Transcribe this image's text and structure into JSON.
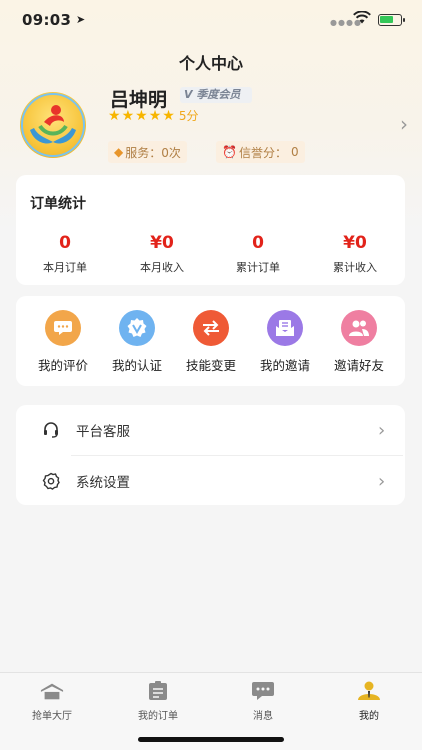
{
  "status": {
    "time": "09:03"
  },
  "page": {
    "title": "个人中心"
  },
  "profile": {
    "name": "吕坤明",
    "vip": "V 季度会员",
    "stars": 5,
    "score": "5分",
    "service_label": "服务：",
    "service_value": "0次",
    "credit_label": "信誉分：",
    "credit_value": "0"
  },
  "order_stats": {
    "title": "订单统计",
    "items": [
      {
        "value": "0",
        "label": "本月订单"
      },
      {
        "value": "¥0",
        "label": "本月收入"
      },
      {
        "value": "0",
        "label": "累计订单"
      },
      {
        "value": "¥0",
        "label": "累计收入"
      }
    ]
  },
  "menu": [
    {
      "label": "我的评价",
      "icon": "comment-icon",
      "color": "#f2a64a"
    },
    {
      "label": "我的认证",
      "icon": "verify-icon",
      "color": "#6fb3f0"
    },
    {
      "label": "技能变更",
      "icon": "swap-icon",
      "color": "#ef5a36"
    },
    {
      "label": "我的邀请",
      "icon": "mail-icon",
      "color": "#9b79e6"
    },
    {
      "label": "邀请好友",
      "icon": "friends-icon",
      "color": "#ef7fa1"
    }
  ],
  "settings": [
    {
      "label": "平台客服",
      "icon": "headset-icon"
    },
    {
      "label": "系统设置",
      "icon": "gear-icon"
    }
  ],
  "tabs": [
    {
      "label": "抢单大厅",
      "icon": "hall-icon"
    },
    {
      "label": "我的订单",
      "icon": "clipboard-icon"
    },
    {
      "label": "消息",
      "icon": "message-icon"
    },
    {
      "label": "我的",
      "icon": "profile-icon"
    }
  ]
}
